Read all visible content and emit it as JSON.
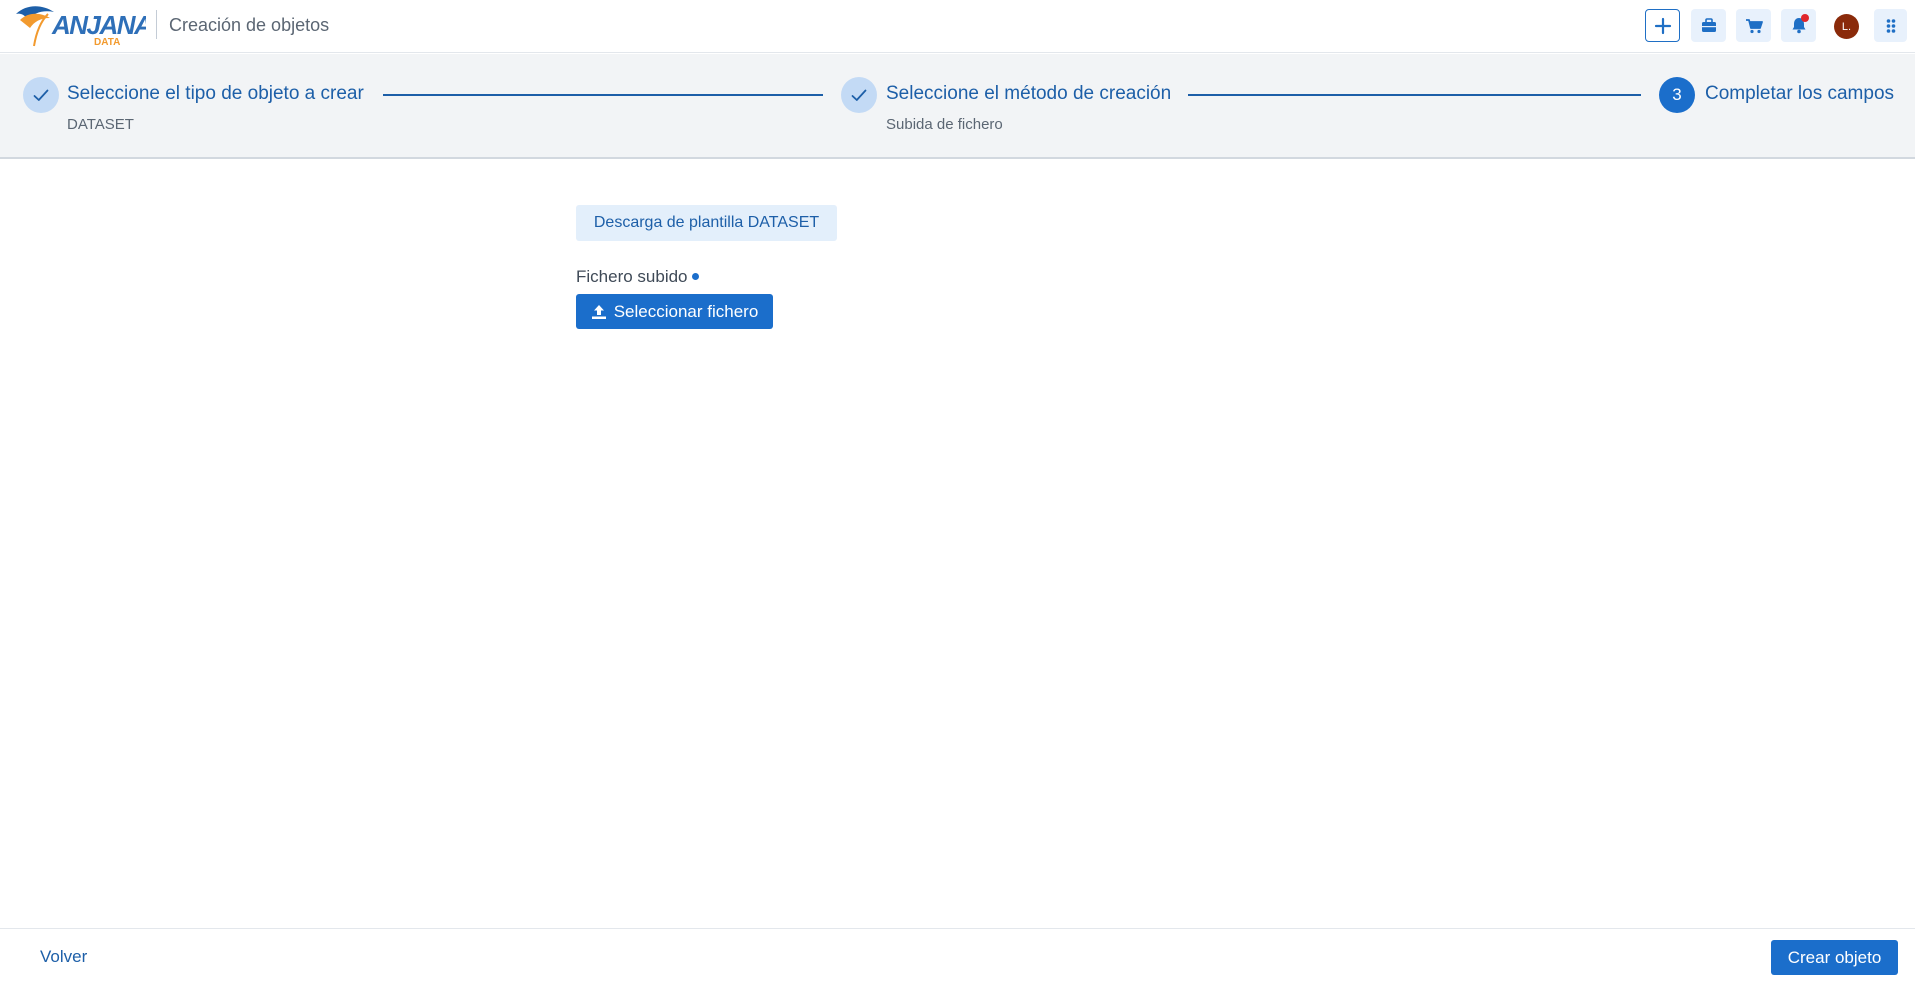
{
  "header": {
    "logo_text": "ANJANA",
    "logo_subtext": "DATA",
    "page_title": "Creación de objetos",
    "avatar_initial": "L.",
    "icons": [
      "plus-icon",
      "briefcase-icon",
      "cart-icon",
      "bell-icon",
      "avatar",
      "apps-grid-icon"
    ]
  },
  "stepper": {
    "steps": [
      {
        "title": "Seleccione el tipo de objeto a crear",
        "subtitle": "DATASET",
        "state": "done"
      },
      {
        "title": "Seleccione el método de creación",
        "subtitle": "Subida de fichero",
        "state": "done"
      },
      {
        "number": "3",
        "title": "Completar los campos",
        "subtitle": "",
        "state": "active"
      }
    ]
  },
  "main": {
    "template_button": "Descarga de plantilla DATASET",
    "file_label": "Fichero subido",
    "upload_button": "Seleccionar fichero"
  },
  "footer": {
    "back_label": "Volver",
    "create_label": "Crear objeto"
  },
  "colors": {
    "primary": "#1b6ecb",
    "primary_text": "#1d5fa8",
    "light_blue": "#e3effb",
    "stepper_bg": "#f2f4f6",
    "notification": "#e0262b",
    "avatar_bg": "#8a2a0a",
    "logo_orange": "#f29a2e"
  }
}
